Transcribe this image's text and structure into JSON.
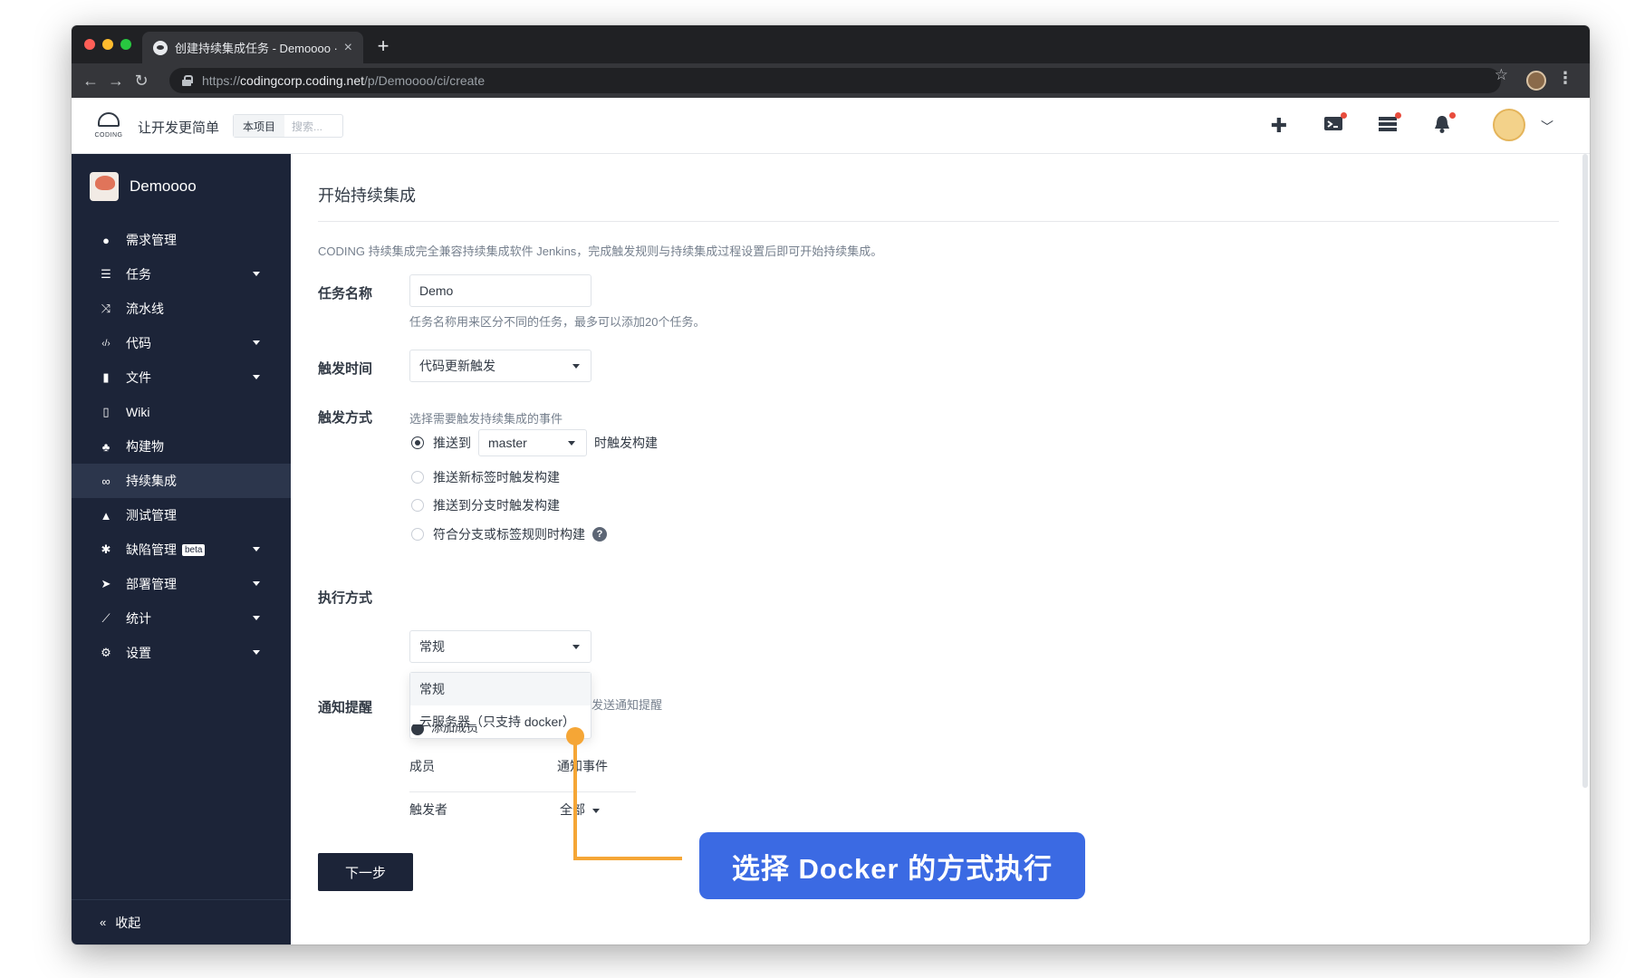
{
  "browser": {
    "tab_title": "创建持续集成任务 - Demoooo ·",
    "tab_close": "×",
    "new_tab": "+",
    "url_scheme": "https://",
    "url_host": "codingcorp.coding.net",
    "url_path": "/p/Demoooo/ci/create",
    "back": "←",
    "forward": "→",
    "reload": "↻",
    "bookmark": "☆",
    "menu": "⋮"
  },
  "header": {
    "logo_text": "CODING",
    "slogan": "让开发更简单",
    "scope_label": "本项目",
    "search_placeholder": "搜索...",
    "icons": [
      "plus-icon",
      "terminal-icon",
      "list-icon",
      "bell-icon"
    ]
  },
  "sidebar": {
    "project_name": "Demoooo",
    "items": [
      {
        "label": "需求管理",
        "icon": "●",
        "caret": false
      },
      {
        "label": "任务",
        "icon": "☰",
        "caret": true
      },
      {
        "label": "流水线",
        "icon": "⤨",
        "caret": false
      },
      {
        "label": "代码",
        "icon": "‹/›",
        "caret": true
      },
      {
        "label": "文件",
        "icon": "▮",
        "caret": true
      },
      {
        "label": "Wiki",
        "icon": "▯",
        "caret": false
      },
      {
        "label": "构建物",
        "icon": "♣",
        "caret": false
      },
      {
        "label": "持续集成",
        "icon": "∞",
        "caret": false,
        "active": true
      },
      {
        "label": "测试管理",
        "icon": "▲",
        "caret": false
      },
      {
        "label": "缺陷管理",
        "icon": "✱",
        "caret": true,
        "badge": "beta"
      },
      {
        "label": "部署管理",
        "icon": "➤",
        "caret": true
      },
      {
        "label": "统计",
        "icon": "⟋",
        "caret": true
      },
      {
        "label": "设置",
        "icon": "⚙",
        "caret": true
      }
    ],
    "collapse_label": "收起",
    "collapse_icon": "«"
  },
  "main": {
    "title": "开始持续集成",
    "description": "CODING 持续集成完全兼容持续集成软件 Jenkins，完成触发规则与持续集成过程设置后即可开始持续集成。",
    "task_name_label": "任务名称",
    "task_name_value": "Demo",
    "task_name_hint": "任务名称用来区分不同的任务，最多可以添加20个任务。",
    "trigger_time_label": "触发时间",
    "trigger_time_value": "代码更新触发",
    "trigger_mode_label": "触发方式",
    "trigger_mode_hint": "选择需要触发持续集成的事件",
    "trigger_options": [
      {
        "prefix": "推送到",
        "branch": "master",
        "suffix": "时触发构建",
        "checked": true
      },
      {
        "label": "推送新标签时触发构建",
        "checked": false
      },
      {
        "label": "推送到分支时触发构建",
        "checked": false
      },
      {
        "label": "符合分支或标签规则时构建",
        "checked": false,
        "help": "?"
      }
    ],
    "exec_mode_label": "执行方式",
    "exec_mode_value": "常规",
    "exec_mode_options": [
      "常规",
      "云服务器（只支持 docker）"
    ],
    "notify_label": "通知提醒",
    "notify_hint_partial": "发送通知提醒",
    "add_member_partial": "添加成员",
    "table_headers": [
      "成员",
      "通知事件"
    ],
    "table_row": {
      "member": "触发者",
      "event": "全部"
    },
    "next_button": "下一步"
  },
  "callout": {
    "text": "选择 Docker 的方式执行",
    "color": "#3b6ae3",
    "line_color": "#f5a636"
  }
}
